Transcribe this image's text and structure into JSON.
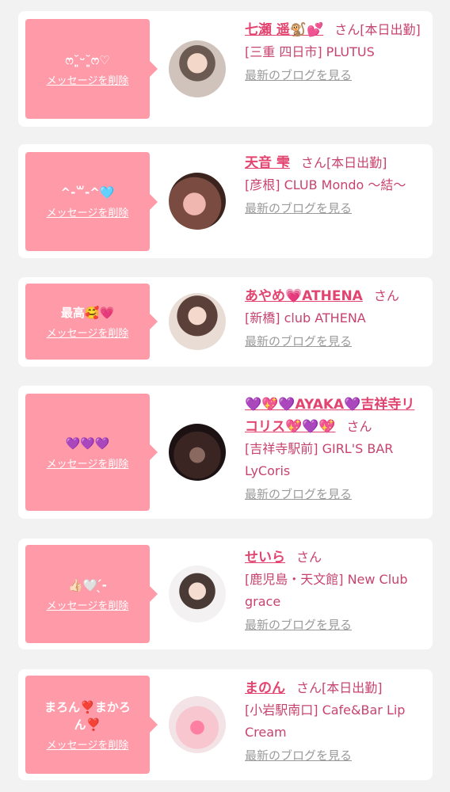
{
  "delete_label": "メッセージを削除",
  "blog_label": "最新のブログを見る",
  "honorific": "さん",
  "colors": {
    "bubble": "#ff9aa9",
    "name": "#e2446f",
    "text": "#c7436e",
    "muted": "#9a9a9a",
    "page_bg": "#f2f2f2"
  },
  "cards": [
    {
      "message": "ෆ˘͈ᵕ˘͈ෆ♡",
      "name": "七瀬 遥🐒💕",
      "status": "[本日出勤]",
      "shop": "[三重 四日市] PLUTUS"
    },
    {
      "message": "^-꒳-^🩵",
      "name": "天音 雫",
      "status": "[本日出勤]",
      "shop": "[彦根] CLUB Mondo 〜結〜"
    },
    {
      "message": "最高🥰💗",
      "name": "あやめ💗ATHENA",
      "status": "",
      "shop": "[新橋] club ATHENA"
    },
    {
      "message": "💜💜💜",
      "name": "💜💖💜AYAKA💜吉祥寺リコリス💖💜💖",
      "status": "",
      "shop": "[吉祥寺駅前] GIRL'S BAR LyCoris"
    },
    {
      "message": "👍🏻🤍 ̖́-",
      "name": "せいら",
      "status": "",
      "shop": "[鹿児島・天文館] New Club grace"
    },
    {
      "message": "まろん❣️まかろん❣️",
      "name": "まのん",
      "status": "[本日出勤]",
      "shop": "[小岩駅南口] Cafe&Bar Lip Cream"
    }
  ]
}
